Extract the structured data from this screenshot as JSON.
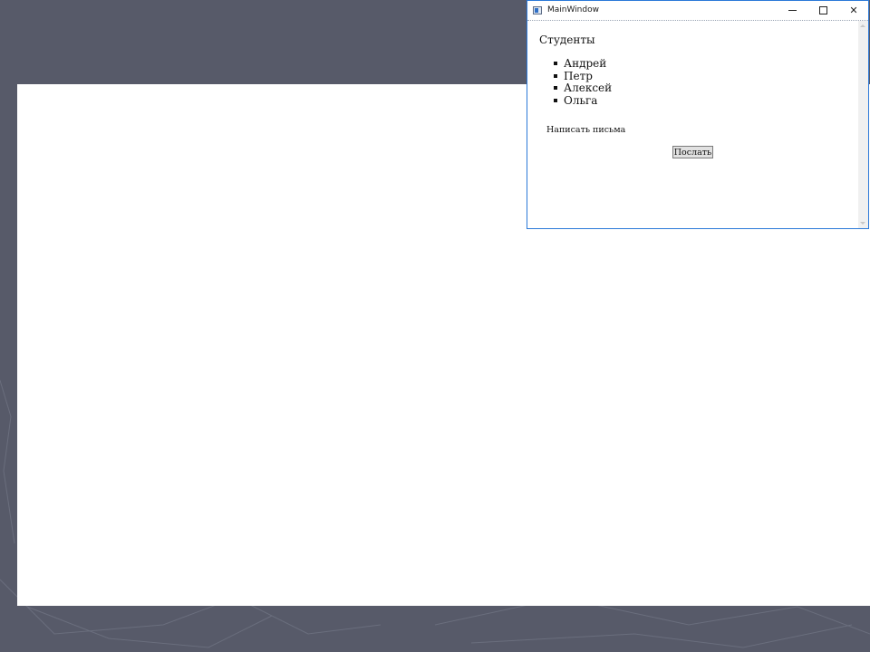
{
  "window": {
    "title": "MainWindow",
    "minimize_icon": "minimize-icon",
    "maximize_icon": "maximize-icon",
    "close_icon": "close-icon",
    "close_glyph": "✕"
  },
  "content": {
    "heading": "Студенты",
    "students": [
      "Андрей",
      "Петр",
      "Алексей",
      "Ольга"
    ],
    "write_label": "Написать письма",
    "send_button": "Послать"
  },
  "colors": {
    "desktop_background": "#575a69",
    "window_border": "#2b79d8",
    "button_face": "#e1e1e1"
  }
}
